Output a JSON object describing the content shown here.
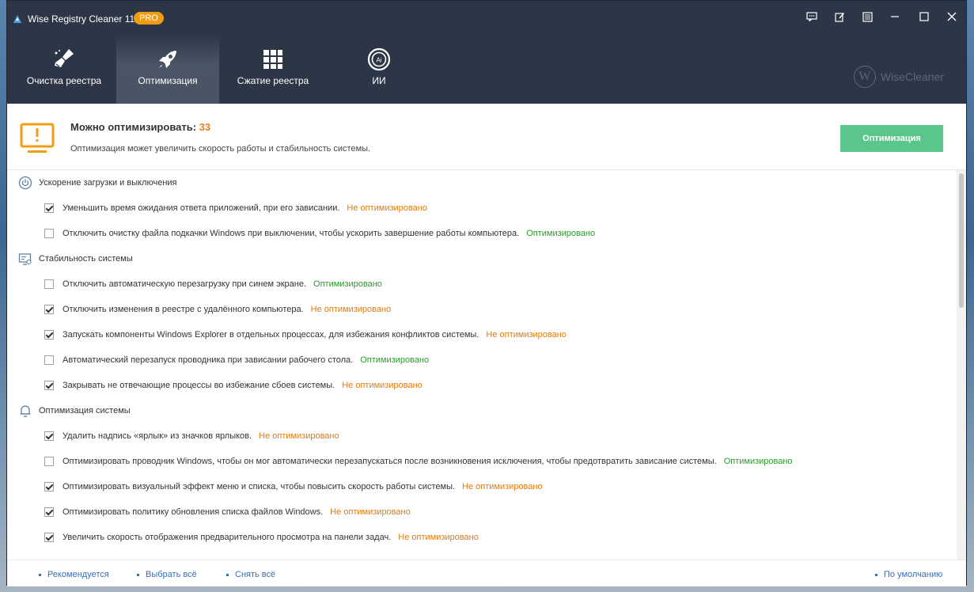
{
  "window": {
    "title": "Wise Registry Cleaner 11",
    "badge": "PRO"
  },
  "tabs": [
    {
      "label": "Очистка реестра",
      "icon": "broom-icon",
      "active": false
    },
    {
      "label": "Оптимизация",
      "icon": "rocket-icon",
      "active": true
    },
    {
      "label": "Сжатие реестра",
      "icon": "grid-icon",
      "active": false
    },
    {
      "label": "ИИ",
      "icon": "ai-icon",
      "active": false
    }
  ],
  "brand": {
    "letter": "W",
    "name": "WiseCleaner"
  },
  "summary": {
    "title_prefix": "Можно оптимизировать: ",
    "count": "33",
    "description": "Оптимизация может увеличить скорость работы и стабильность системы.",
    "button": "Оптимизация"
  },
  "sections": [
    {
      "title": "Ускорение загрузки и выключения",
      "icon": "power-icon",
      "items": [
        {
          "text": "Уменьшить время ожидания ответа приложений, при его зависании.",
          "checked": true,
          "status": "Не оптимизировано"
        },
        {
          "text": "Отключить очистку файла подкачки Windows при выключении, чтобы ускорить завершение работы компьютера.",
          "checked": false,
          "status": "Оптимизировано"
        }
      ]
    },
    {
      "title": "Стабильность системы",
      "icon": "monitor-settings-icon",
      "items": [
        {
          "text": "Отключить автоматическую перезагрузку при синем экране.",
          "checked": false,
          "status": "Оптимизировано"
        },
        {
          "text": "Отключить изменения в реестре с удалённого компьютера.",
          "checked": true,
          "status": "Не оптимизировано"
        },
        {
          "text": "Запускать компоненты Windows Explorer в отдельных процессах, для избежания конфликтов системы.",
          "checked": true,
          "status": "Не оптимизировано"
        },
        {
          "text": "Автоматический перезапуск проводника при зависании рабочего стола.",
          "checked": false,
          "status": "Оптимизировано"
        },
        {
          "text": "Закрывать не отвечающие процессы во избежание сбоев системы.",
          "checked": true,
          "status": "Не оптимизировано"
        }
      ]
    },
    {
      "title": "Оптимизация системы",
      "icon": "bell-icon",
      "items": [
        {
          "text": "Удалить надпись «ярлык» из значков ярлыков.",
          "checked": true,
          "status": "Не оптимизировано"
        },
        {
          "text": "Оптимизировать проводник Windows, чтобы он мог автоматически перезапускаться после возникновения исключения, чтобы предотвратить зависание системы.",
          "checked": false,
          "status": "Оптимизировано"
        },
        {
          "text": "Оптимизировать визуальный эффект меню и списка, чтобы повысить скорость работы системы.",
          "checked": true,
          "status": "Не оптимизировано"
        },
        {
          "text": "Оптимизировать политику обновления списка файлов Windows.",
          "checked": true,
          "status": "Не оптимизировано"
        },
        {
          "text": "Увеличить скорость отображения предварительного просмотра на панели задач.",
          "checked": true,
          "status": "Не оптимизировано"
        }
      ]
    }
  ],
  "footer": {
    "recommended": "Рекомендуется",
    "select_all": "Выбрать всё",
    "deselect_all": "Снять всё",
    "default": "По умолчанию"
  },
  "colors": {
    "header_bg": "#2d3646",
    "accent_orange": "#f39c12",
    "status_bad": "#e07b10",
    "status_good": "#2c9a2c",
    "button_green": "#5bc68b",
    "link_blue": "#3a6fb0"
  }
}
